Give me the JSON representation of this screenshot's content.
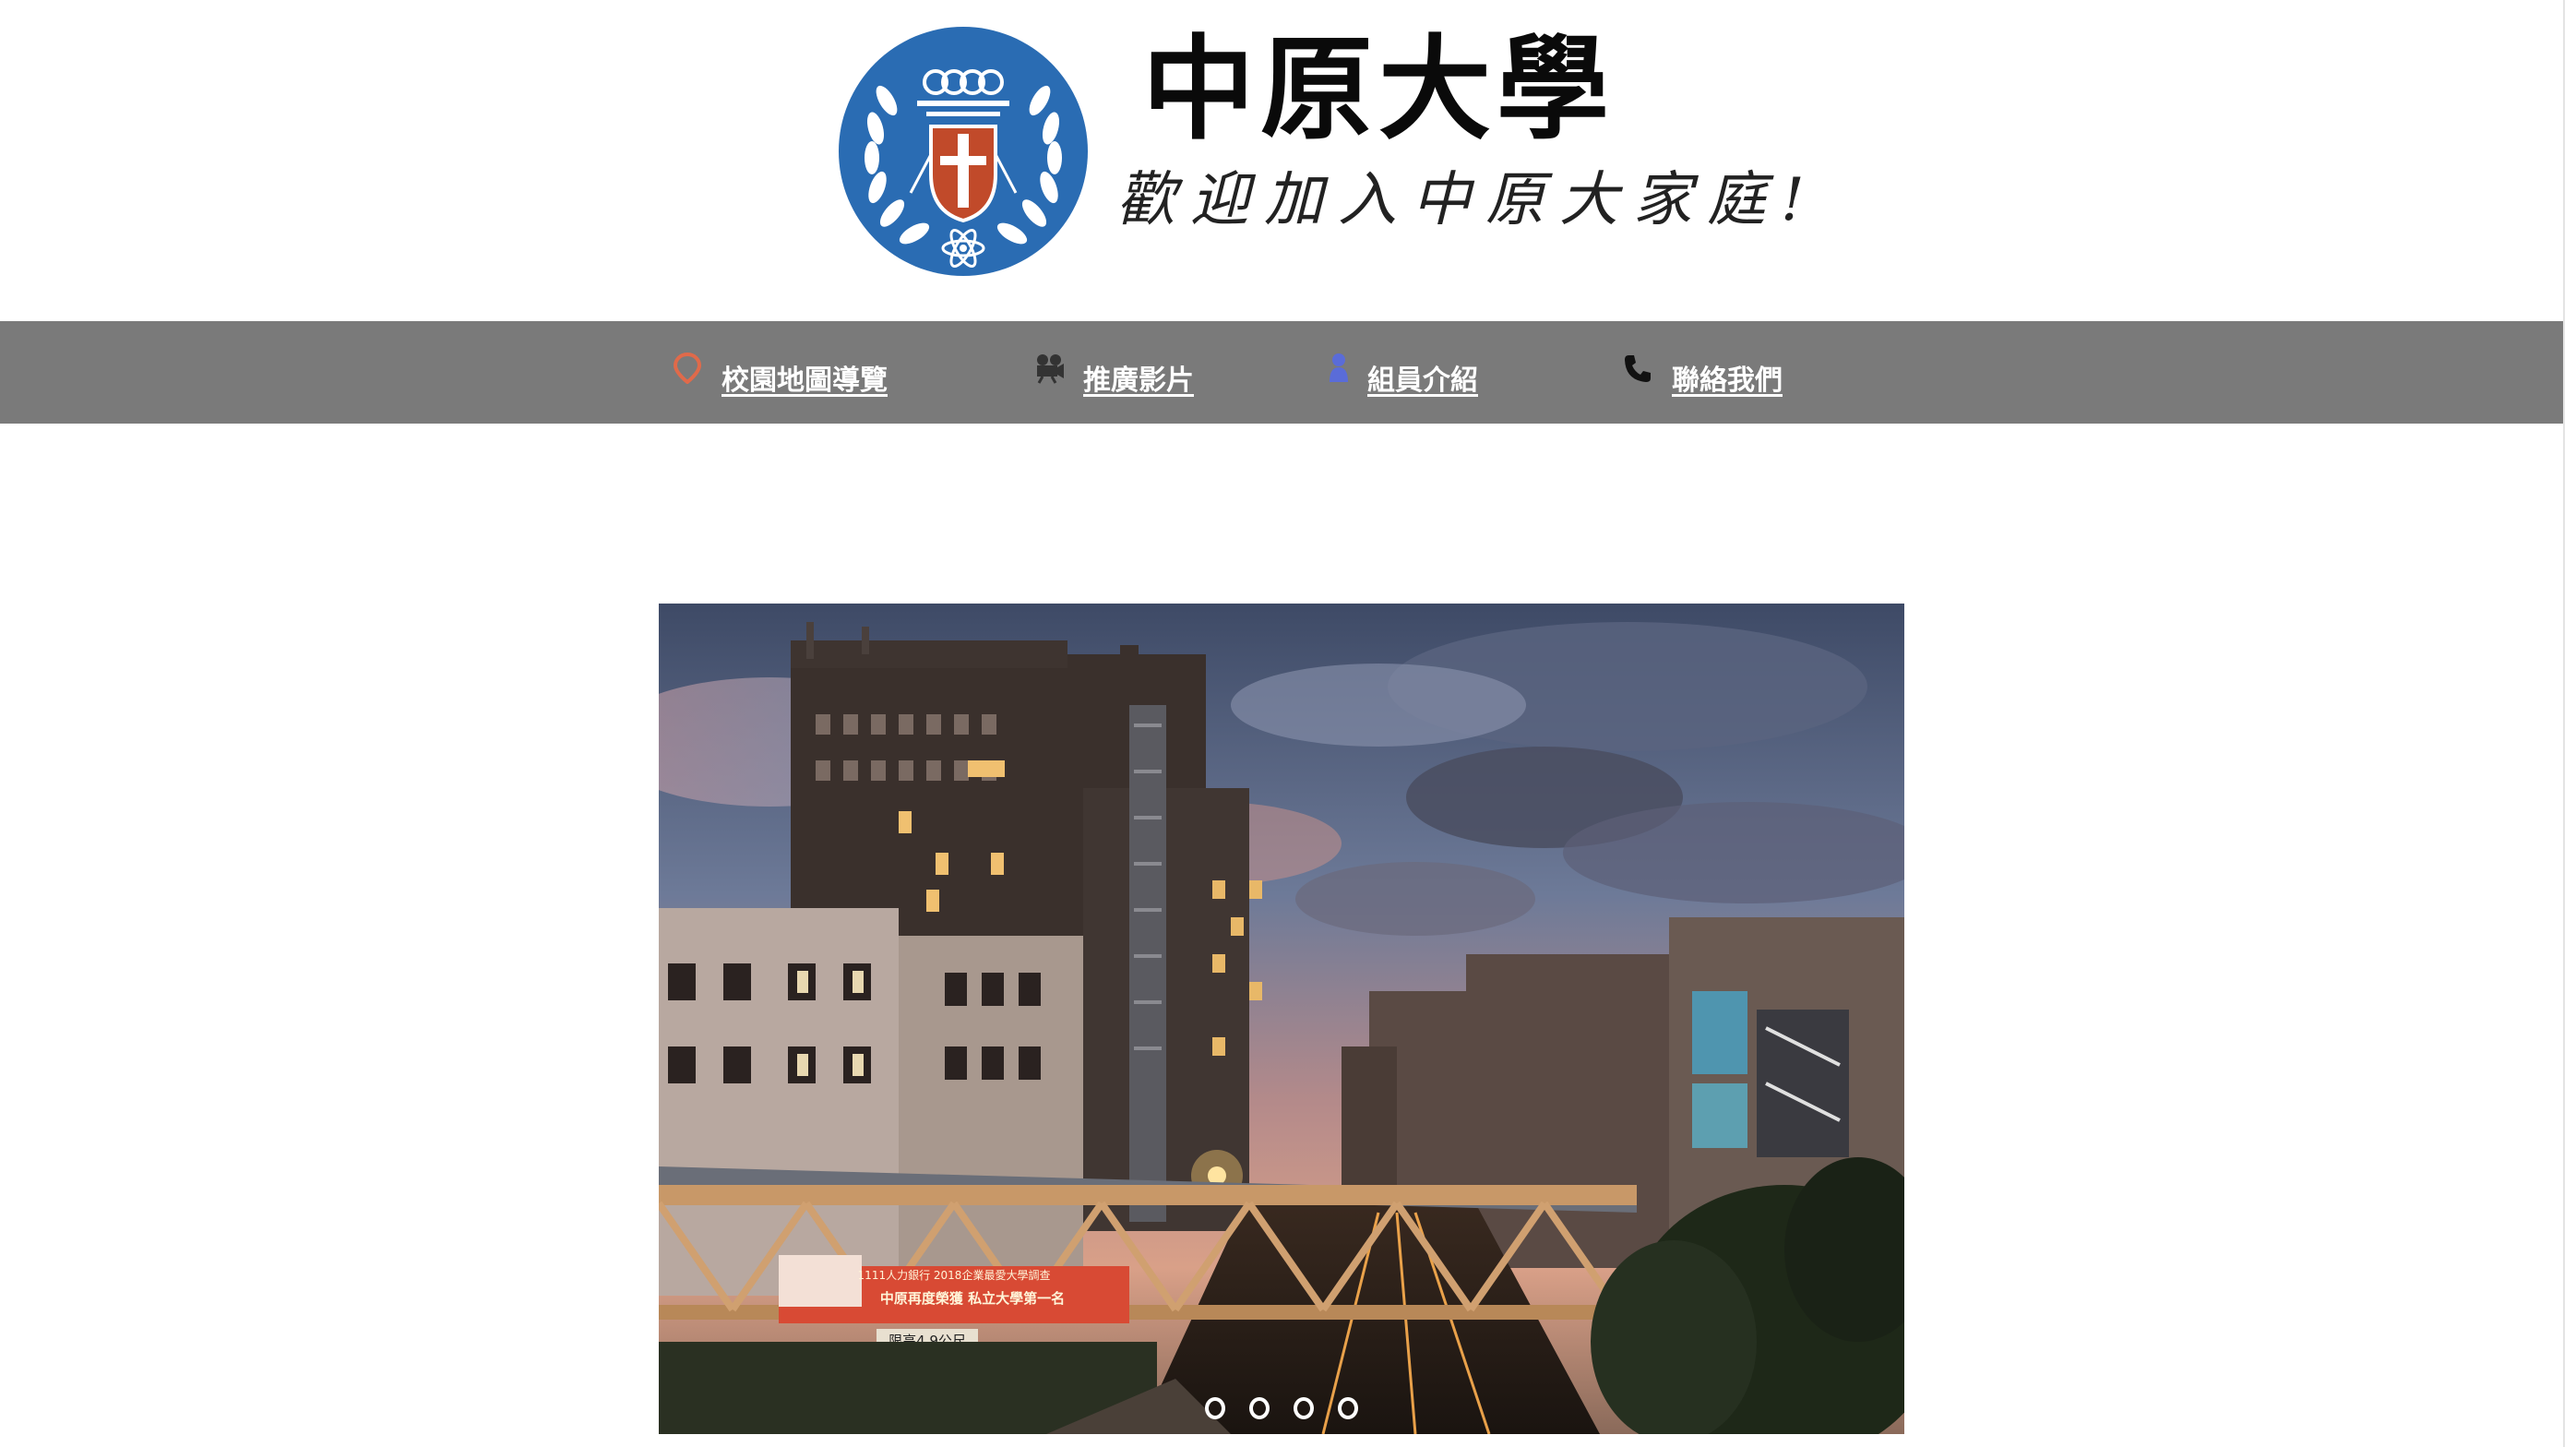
{
  "header": {
    "title": "中原大學",
    "subtitle": "歡迎加入中原大家庭!"
  },
  "nav": {
    "items": [
      {
        "label": "校園地圖導覽",
        "icon": "map-pin-icon",
        "color": "#e06a4a"
      },
      {
        "label": "推廣影片",
        "icon": "film-camera-icon",
        "color": "#333333"
      },
      {
        "label": "組員介紹",
        "icon": "person-icon",
        "color": "#5a6cd8"
      },
      {
        "label": "聯絡我們",
        "icon": "phone-icon",
        "color": "#111111"
      }
    ]
  },
  "logo": {
    "name": "university-emblem",
    "colors": {
      "ring": "#2a6cb3",
      "shield": "#c14a2a"
    }
  },
  "hero": {
    "banner_line1": "1111人力銀行 2018企業最愛大學調查",
    "banner_line2": "中原再度榮獲 私立大學第一名",
    "height_sign": "限高4.9公尺",
    "slide_count": 4,
    "active_slide": 1
  },
  "colors": {
    "navbar": "#7a7a7a",
    "background": "#ffffff"
  }
}
